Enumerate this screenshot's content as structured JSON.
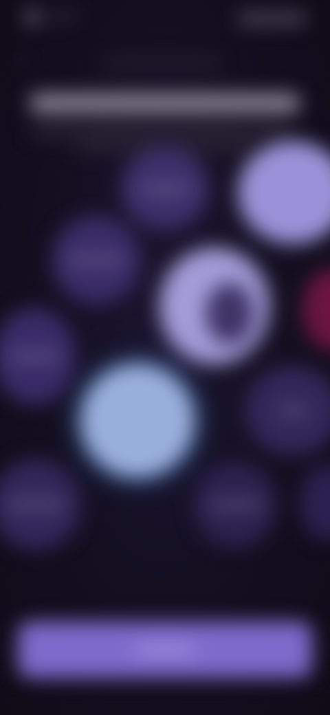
{
  "status_bar": {
    "icons": [
      "app-notification-icon",
      "signal-icon",
      "wifi-icon",
      "battery-icon"
    ]
  },
  "header": {
    "back_icon": "back-arrow-icon",
    "back_glyph": "‹"
  },
  "colors": {
    "background": "#0f0b17",
    "accent": "#7d6acb",
    "bubble_default": "#3b2c68",
    "bubble_selected": "#a49cd8",
    "bubble_highlight_blue": "#9ab0dc",
    "bubble_red": "#6b1540"
  },
  "bubbles": [
    {
      "id": 1,
      "selected": false
    },
    {
      "id": 2,
      "selected": true
    },
    {
      "id": 3,
      "selected": false
    },
    {
      "id": 4,
      "selected": true
    },
    {
      "id": 5,
      "selected": false
    },
    {
      "id": 6,
      "selected": false
    },
    {
      "id": 7,
      "selected": true
    },
    {
      "id": 8,
      "selected": false
    },
    {
      "id": 9,
      "selected": false
    },
    {
      "id": 10,
      "selected": false
    },
    {
      "id": 11,
      "selected": false
    }
  ]
}
